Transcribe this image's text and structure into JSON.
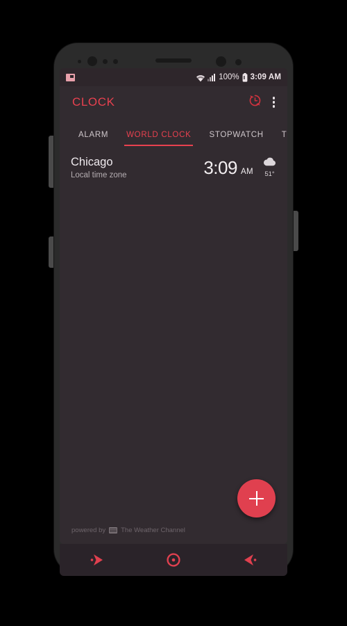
{
  "device": {
    "frame_color": "#2b2b2b",
    "buttons": [
      {
        "name": "volume-rocker"
      },
      {
        "name": "bixby-button"
      },
      {
        "name": "power-button"
      }
    ]
  },
  "theme": {
    "accent": "#e8414f",
    "fab": "#e0404f",
    "screen_bg": "#322b30",
    "statusbar_bg": "#2e262b",
    "navbar_bg": "#2a2329"
  },
  "statusbar": {
    "notification_icon": "image-notification-icon",
    "wifi_icon": "wifi-icon",
    "signal_icon": "cellular-signal-icon",
    "battery_percent": "100%",
    "battery_icon": "battery-full-icon",
    "time": "3:09 AM"
  },
  "appbar": {
    "title": "CLOCK",
    "actions": [
      {
        "name": "reset-clock-icon",
        "label": "reset"
      },
      {
        "name": "overflow-menu-icon",
        "label": "More options"
      }
    ]
  },
  "tabs": [
    {
      "label": "ALARM",
      "active": false
    },
    {
      "label": "WORLD CLOCK",
      "active": true
    },
    {
      "label": "STOPWATCH",
      "active": false
    },
    {
      "label": "TIMER",
      "active": false
    }
  ],
  "world_clock": {
    "entries": [
      {
        "city": "Chicago",
        "timezone_label": "Local time zone",
        "time": "3:09",
        "ampm": "AM",
        "weather_icon": "cloud-icon",
        "temperature": "51°"
      }
    ]
  },
  "footer": {
    "attribution_prefix": "powered by",
    "attribution_brand": "The Weather Channel",
    "logo_icon": "weather-channel-logo-icon"
  },
  "fab": {
    "icon": "plus-icon",
    "label": "Add city"
  },
  "navbar": {
    "buttons": [
      {
        "name": "recents-button",
        "icon": "recents-arrow-icon"
      },
      {
        "name": "home-button",
        "icon": "home-circle-icon"
      },
      {
        "name": "back-button",
        "icon": "back-arrow-icon"
      }
    ]
  }
}
